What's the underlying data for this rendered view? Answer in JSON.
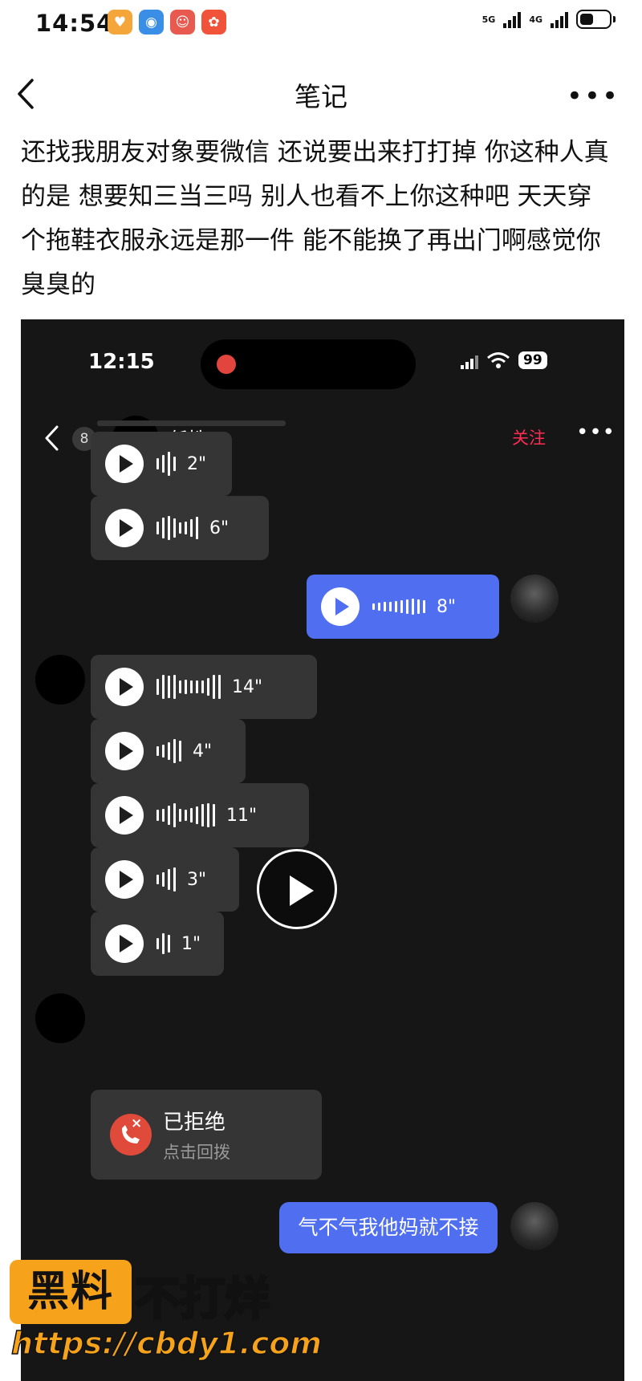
{
  "status_bar": {
    "time": "14:54",
    "net1": "5G",
    "net2": "4G"
  },
  "nav": {
    "title": "笔记"
  },
  "post": {
    "text": "还找我朋友对象要微信 还说要出来打打掉 你这种人真的是 想要知三当三吗 别人也看不上你这种吧 天天穿个拖鞋衣服永远是那一件 能不能换了再出门啊感觉你臭臭的"
  },
  "screenshot": {
    "status": {
      "time": "12:15",
      "battery": "99"
    },
    "header": {
      "badge": "8",
      "name": "任性",
      "follow": "关注"
    },
    "voices": [
      {
        "duration": "2\"",
        "side": "received"
      },
      {
        "duration": "6\"",
        "side": "received"
      },
      {
        "duration": "8\"",
        "side": "sent"
      },
      {
        "duration": "14\"",
        "side": "received"
      },
      {
        "duration": "4\"",
        "side": "received"
      },
      {
        "duration": "11\"",
        "side": "received"
      },
      {
        "duration": "3\"",
        "side": "received"
      },
      {
        "duration": "1\"",
        "side": "received"
      }
    ],
    "call": {
      "title": "已拒绝",
      "subtitle": "点击回拨"
    },
    "text_message": "气不气我他妈就不接"
  },
  "watermark": {
    "box": "黑料",
    "side": "不打烊",
    "url": "https://cbdy1.com"
  },
  "colors": {
    "sent_bubble": "#4f6ef0",
    "follow": "#ff2d55",
    "watermark": "#f6a21a"
  }
}
